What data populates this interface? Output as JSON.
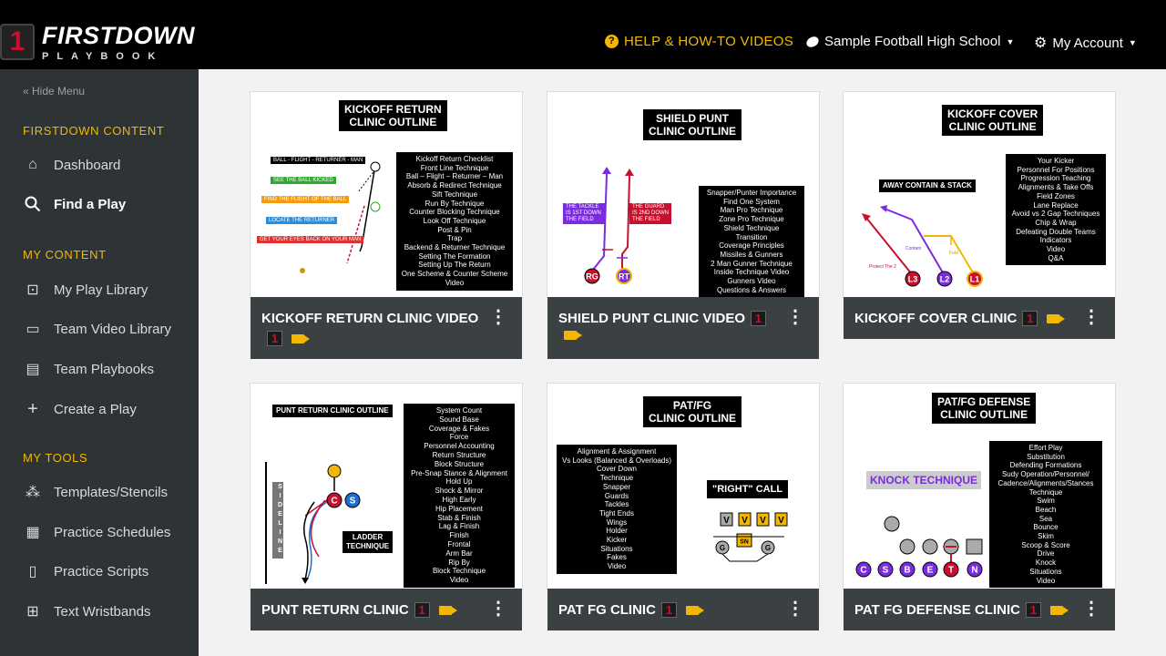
{
  "brand": {
    "badge": "1",
    "name": "FIRSTDOWN",
    "sub": "PLAYBOOK"
  },
  "header": {
    "help": "HELP & HOW-TO VIDEOS",
    "school": "Sample Football High School",
    "account": "My Account"
  },
  "sidebar": {
    "hide_menu": "Hide Menu",
    "sections": [
      {
        "title": "FIRSTDOWN CONTENT",
        "items": [
          {
            "label": "Dashboard",
            "icon": "home-icon"
          },
          {
            "label": "Find a Play",
            "icon": "search-icon"
          }
        ]
      },
      {
        "title": "MY CONTENT",
        "items": [
          {
            "label": "My Play Library",
            "icon": "library-icon"
          },
          {
            "label": "Team Video Library",
            "icon": "video-icon"
          },
          {
            "label": "Team Playbooks",
            "icon": "book-icon"
          },
          {
            "label": "Create a Play",
            "icon": "plus-icon"
          }
        ]
      },
      {
        "title": "MY TOOLS",
        "items": [
          {
            "label": "Templates/Stencils",
            "icon": "stencil-icon"
          },
          {
            "label": "Practice Schedules",
            "icon": "grid-icon"
          },
          {
            "label": "Practice Scripts",
            "icon": "script-icon"
          },
          {
            "label": "Text Wristbands",
            "icon": "wristband-icon"
          }
        ]
      }
    ]
  },
  "cards": [
    {
      "title": "KICKOFF RETURN CLINIC VIDEO",
      "outline": [
        "KICKOFF RETURN",
        "CLINIC OUTLINE"
      ],
      "topics": [
        "Kickoff Return Checklist",
        "Front Line Technique",
        "Ball – Flight – Returner – Man",
        "Absorb & Redirect Technique",
        "Sift Technique",
        "Run By Technique",
        "Counter Blocking Technique",
        "Look Off Technique",
        "Post & Pin",
        "Trap",
        "Backend & Returner Technique",
        "Setting The Formation",
        "Setting Up The Return",
        "One Scheme & Counter Scheme",
        "Video"
      ],
      "tags": [
        "BALL - FLIGHT - RETURNER - MAN",
        "SEE THE BALL KICKED",
        "FIND THE FLIGHT OF THE BALL",
        "LOCATE THE RETURNER",
        "GET YOUR EYES BACK ON YOUR MAN"
      ]
    },
    {
      "title": "SHIELD PUNT CLINIC VIDEO",
      "outline": [
        "SHIELD PUNT",
        "CLINIC OUTLINE"
      ],
      "topics": [
        "Snapper/Punter Importance",
        "Find One System",
        "Man Pro Technique",
        "Zone Pro Technique",
        "Shield Technique",
        "Transition",
        "Coverage Principles",
        "Missiles & Gunners",
        "2 Man Gunner Technique",
        "Inside Technique Video",
        "Gunners Video",
        "Questions & Answers"
      ],
      "tags": [
        "THE TACKLE IS 1ST DOWN THE FIELD",
        "THE GUARD IS 2ND DOWN THE FIELD"
      ],
      "players": [
        "RG",
        "RT"
      ]
    },
    {
      "title": "KICKOFF COVER CLINIC",
      "outline": [
        "KICKOFF COVER",
        "CLINIC OUTLINE"
      ],
      "topics": [
        "Your Kicker",
        "Personnel For Positions",
        "Progression Teaching",
        "Alignments & Take Offs",
        "Field Zones",
        "Lane Replace",
        "Avoid vs 2 Gap Techniques",
        "Chip & Wrap",
        "Defeating Double Teams",
        "Indicators",
        "Video",
        "Q&A"
      ],
      "tags": [
        "AWAY CONTAIN & STACK",
        "Protect The 2",
        "Contain",
        "Fold"
      ],
      "players": [
        "L3",
        "L2",
        "L1"
      ]
    },
    {
      "title": "PUNT RETURN CLINIC",
      "outline": [
        "PUNT RETURN CLINIC OUTLINE"
      ],
      "topics": [
        "System Count",
        "Sound Base",
        "Coverage & Fakes",
        "Force",
        "Personnel Accounting",
        "Return Structure",
        "Block Structure",
        "Pre-Snap Stance & Alignment",
        "Hold Up",
        "Shock & Mirror",
        "High Early",
        "Hip Placement",
        "Stab & Finish",
        "Lag & Finish",
        "Finish",
        "Frontal",
        "Arm Bar",
        "Rip By",
        "Block Technique",
        "Video"
      ],
      "tags": [
        "SIDELINE",
        "LADDER",
        "TECHNIQUE"
      ],
      "players": [
        "C",
        "S"
      ]
    },
    {
      "title": "PAT FG CLINIC",
      "outline": [
        "PAT/FG",
        "CLINIC OUTLINE"
      ],
      "topics": [
        "Alignment & Assignment",
        "Vs Looks (Balanced & Overloads)",
        "Cover Down",
        "Technique",
        "Snapper",
        "Guards",
        "Tackles",
        "Tight Ends",
        "Wings",
        "Holder",
        "Kicker",
        "Situations",
        "Fakes",
        "Video"
      ],
      "tags": [
        "\"RIGHT\" CALL",
        "V",
        "V",
        "V",
        "V",
        "SN",
        "G",
        "G"
      ]
    },
    {
      "title": "PAT FG DEFENSE CLINIC",
      "outline": [
        "PAT/FG DEFENSE",
        "CLINIC OUTLINE"
      ],
      "topics": [
        "Effort Play",
        "Substitution",
        "Defending Formations",
        "Sudy Operation/Personnel/",
        "Cadence/Alignments/Stances",
        "Technique",
        "Swim",
        "Beach",
        "Sea",
        "Bounce",
        "Skim",
        "Scoop & Score",
        "Drive",
        "Knock",
        "Situations",
        "Video"
      ],
      "tags": [
        "KNOCK TECHNIQUE"
      ],
      "players": [
        "C",
        "S",
        "B",
        "E",
        "T",
        "N"
      ]
    }
  ],
  "colors": {
    "accent": "#f2b705",
    "sidebar": "#2e3436",
    "card_bar": "#3b4042",
    "logo_red": "#c8102e"
  }
}
